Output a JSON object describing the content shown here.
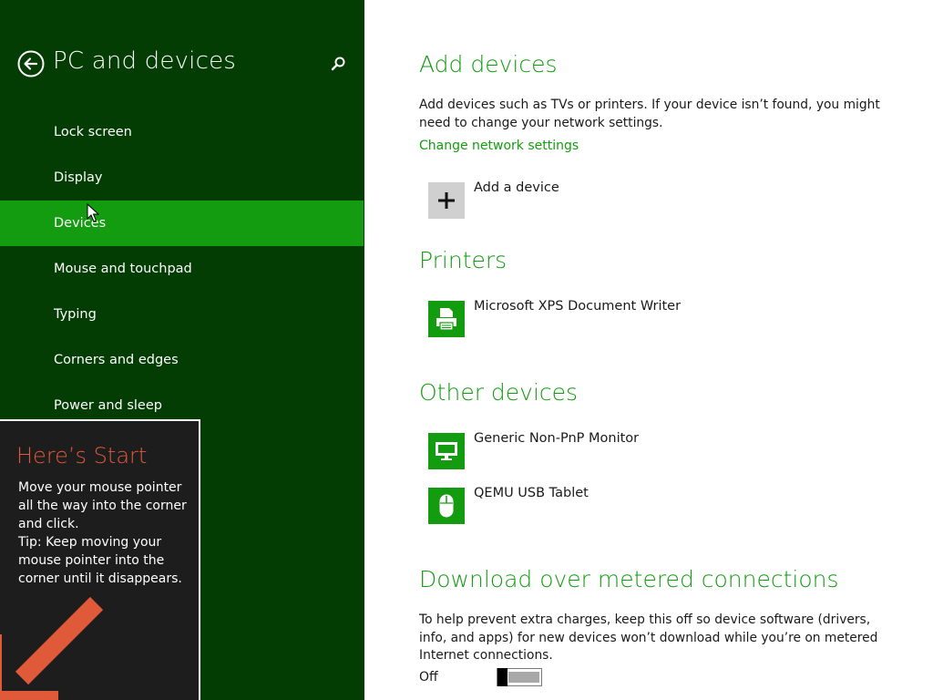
{
  "sidebar": {
    "title": "PC and devices",
    "items": [
      {
        "label": "Lock screen"
      },
      {
        "label": "Display"
      },
      {
        "label": "Devices",
        "selected": true
      },
      {
        "label": "Mouse and touchpad"
      },
      {
        "label": "Typing"
      },
      {
        "label": "Corners and edges"
      },
      {
        "label": "Power and sleep"
      }
    ],
    "icons": {
      "back": "back-arrow-icon",
      "search": "search-icon"
    }
  },
  "tip": {
    "title": "Here’s Start",
    "body": "Move your mouse pointer\nall the way into the corner\nand click.\nTip: Keep moving your\nmouse pointer into the\ncorner until it disappears."
  },
  "main": {
    "add_devices": {
      "heading": "Add devices",
      "description": "Add devices such as TVs or printers. If your device isn’t found, you might need to change your network settings.",
      "link": "Change network settings",
      "add_label": "Add a device"
    },
    "printers": {
      "heading": "Printers",
      "items": [
        {
          "label": "Microsoft XPS Document Writer",
          "icon": "printer-icon"
        }
      ]
    },
    "other_devices": {
      "heading": "Other devices",
      "items": [
        {
          "label": "Generic Non-PnP Monitor",
          "icon": "monitor-icon"
        },
        {
          "label": "QEMU USB Tablet",
          "icon": "mouse-icon"
        }
      ]
    },
    "metered": {
      "heading": "Download over metered connections",
      "description": "To help prevent extra charges, keep this off so device software (drivers, info, and apps) for new devices won’t download while you’re on metered Internet connections.",
      "toggle_state": "Off"
    }
  },
  "colors": {
    "sidebar_bg": "#033d03",
    "accent": "#139c10",
    "tip_title": "#e05a3a",
    "tip_bg": "#1d1d1d"
  }
}
